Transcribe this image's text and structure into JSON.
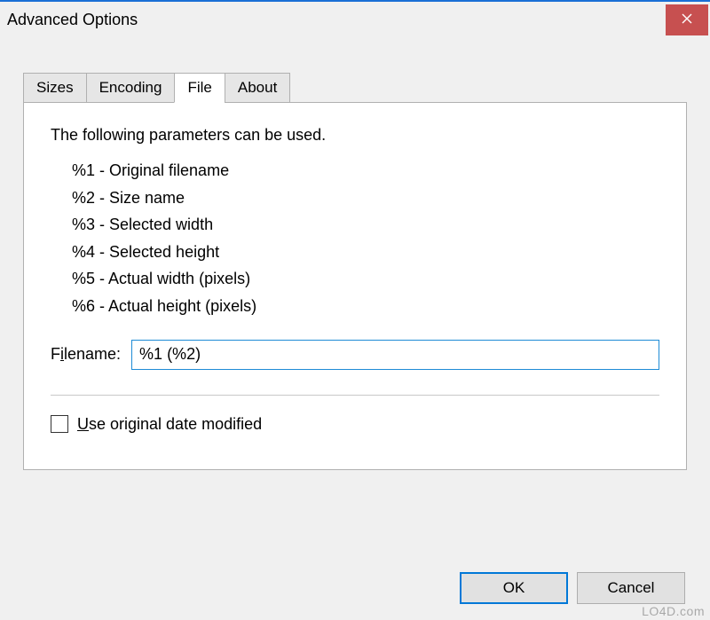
{
  "titlebar": {
    "title": "Advanced Options"
  },
  "tabs": {
    "sizes": "Sizes",
    "encoding": "Encoding",
    "file": "File",
    "about": "About"
  },
  "panel": {
    "intro": "The following parameters can be used.",
    "params": [
      "%1 - Original filename",
      "%2 - Size name",
      "%3 - Selected width",
      "%4 - Selected height",
      "%5 - Actual width (pixels)",
      "%6 - Actual height (pixels)"
    ],
    "filename_label_pre": "F",
    "filename_label_ul": "i",
    "filename_label_post": "lename:",
    "filename_value": "%1 (%2)",
    "check_label_ul": "U",
    "check_label_post": "se original date modified"
  },
  "buttons": {
    "ok": "OK",
    "cancel": "Cancel"
  },
  "watermark": "LO4D.com"
}
